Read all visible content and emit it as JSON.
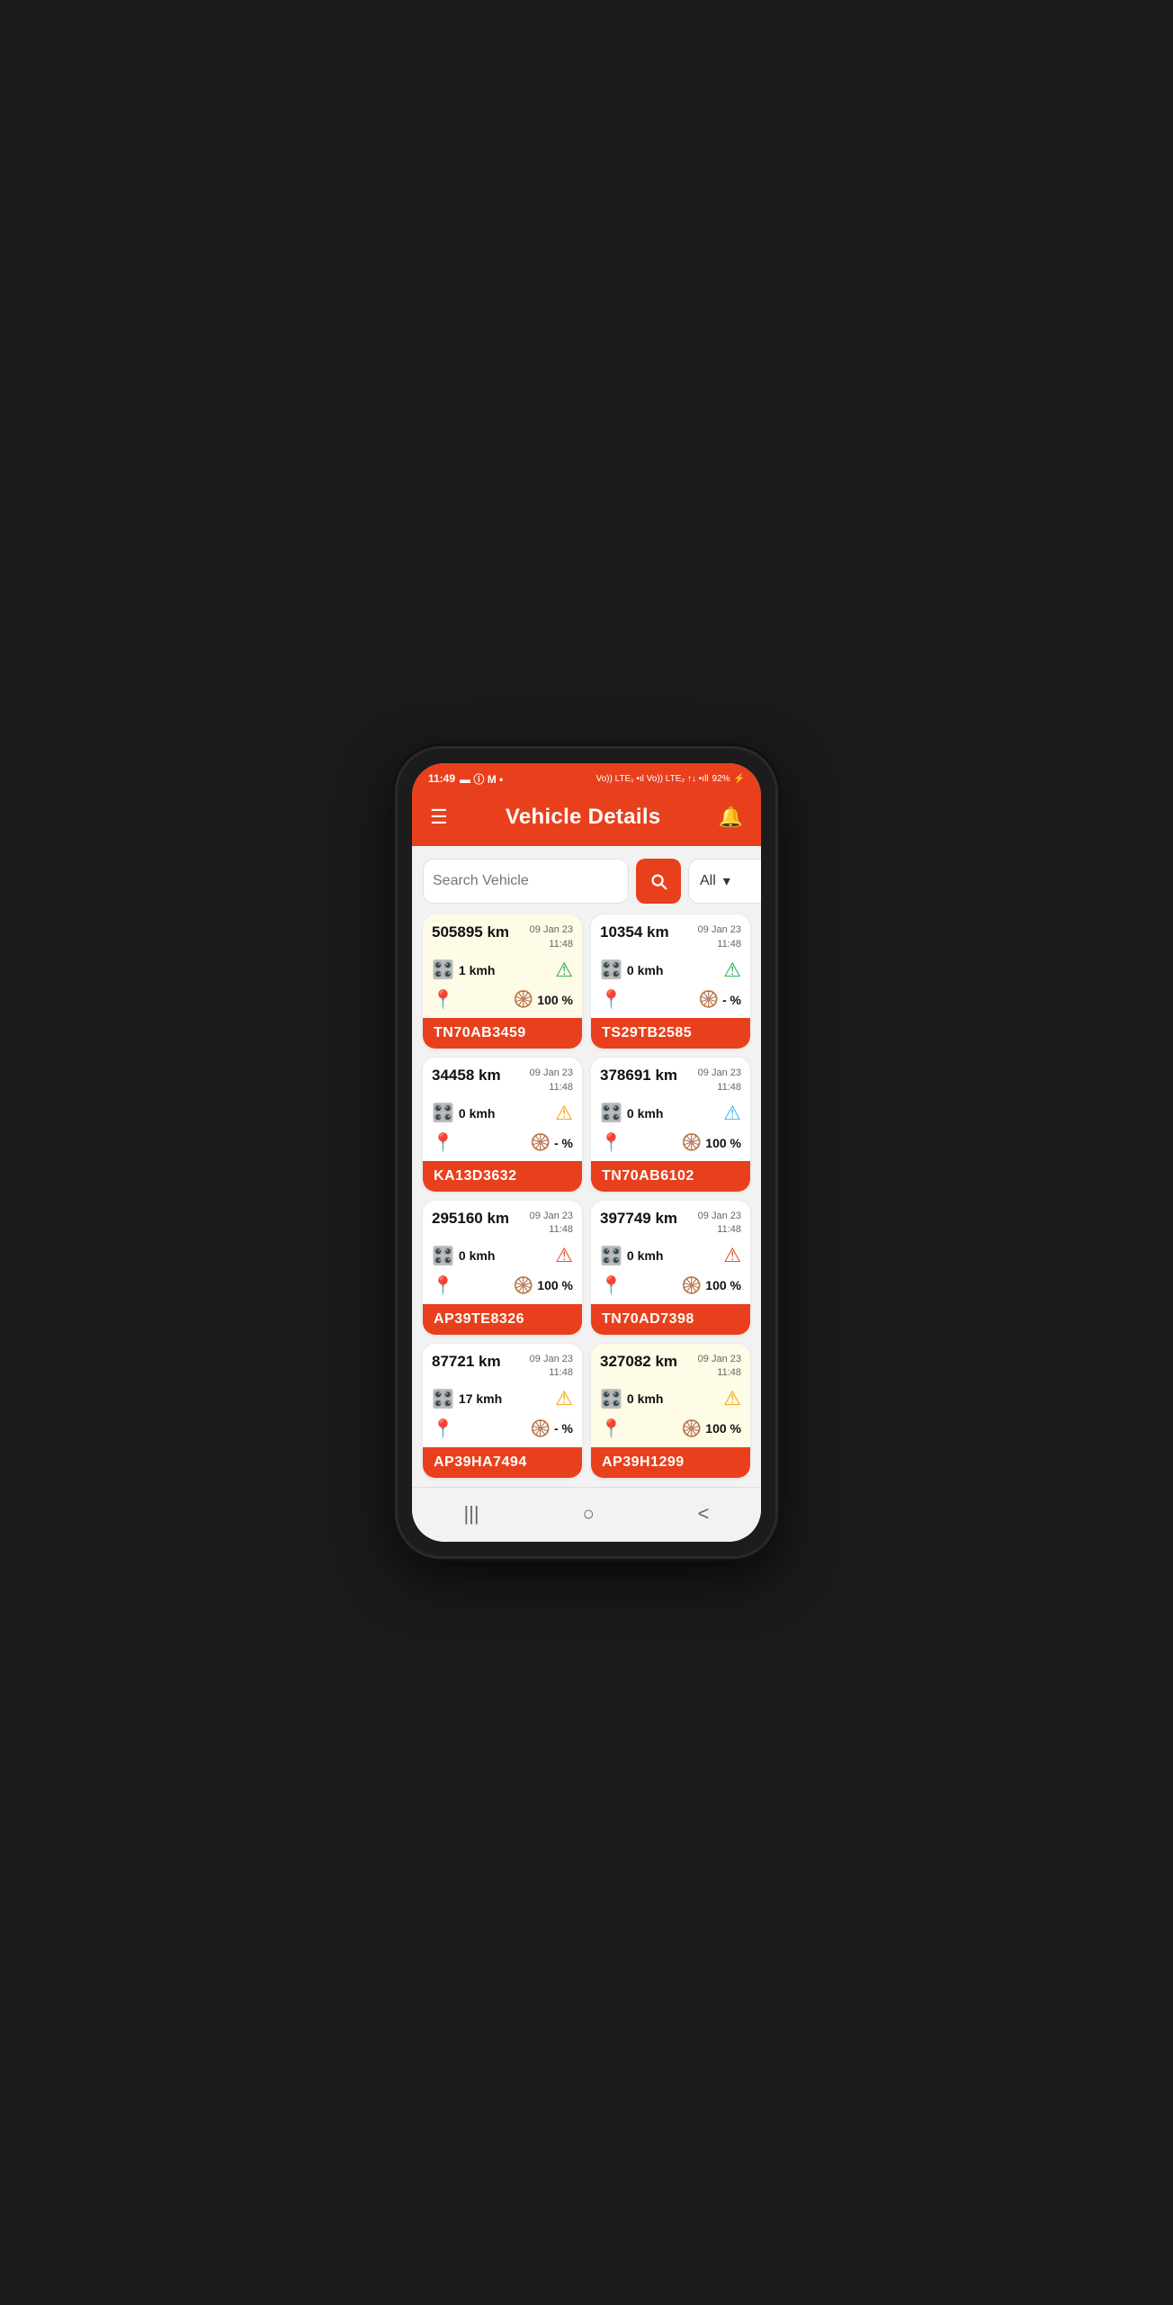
{
  "statusBar": {
    "time": "11:49",
    "batteryPct": "92%"
  },
  "header": {
    "title": "Vehicle Details",
    "menuLabel": "☰",
    "bellLabel": "🔔"
  },
  "search": {
    "placeholder": "Search Vehicle",
    "buttonIcon": "search",
    "filterDefault": "All"
  },
  "vehicles": [
    {
      "id": "v1",
      "km": "505895 km",
      "date": "09 Jan 23",
      "time": "11:48",
      "speed": "1 kmh",
      "warnColor": "green",
      "fuel": "100 %",
      "plate": "TN70AB3459",
      "highlighted": true
    },
    {
      "id": "v2",
      "km": "10354 km",
      "date": "09 Jan 23",
      "time": "11:48",
      "speed": "0 kmh",
      "warnColor": "green",
      "fuel": "- %",
      "plate": "TS29TB2585",
      "highlighted": false
    },
    {
      "id": "v3",
      "km": "34458 km",
      "date": "09 Jan 23",
      "time": "11:48",
      "speed": "0 kmh",
      "warnColor": "orange",
      "fuel": "- %",
      "plate": "KA13D3632",
      "highlighted": false
    },
    {
      "id": "v4",
      "km": "378691 km",
      "date": "09 Jan 23",
      "time": "11:48",
      "speed": "0 kmh",
      "warnColor": "blue",
      "fuel": "100 %",
      "plate": "TN70AB6102",
      "highlighted": false
    },
    {
      "id": "v5",
      "km": "295160 km",
      "date": "09 Jan 23",
      "time": "11:48",
      "speed": "0 kmh",
      "warnColor": "red",
      "fuel": "100 %",
      "plate": "AP39TE8326",
      "highlighted": false
    },
    {
      "id": "v6",
      "km": "397749 km",
      "date": "09 Jan 23",
      "time": "11:48",
      "speed": "0 kmh",
      "warnColor": "red",
      "fuel": "100 %",
      "plate": "TN70AD7398",
      "highlighted": false
    },
    {
      "id": "v7",
      "km": "87721 km",
      "date": "09 Jan 23",
      "time": "11:48",
      "speed": "17 kmh",
      "warnColor": "orange",
      "fuel": "- %",
      "plate": "AP39HA7494",
      "highlighted": false
    },
    {
      "id": "v8",
      "km": "327082 km",
      "date": "09 Jan 23",
      "time": "11:48",
      "speed": "0 kmh",
      "warnColor": "orange",
      "fuel": "100 %",
      "plate": "AP39H1299",
      "highlighted": true
    }
  ],
  "navbar": {
    "recentLabel": "|||",
    "homeLabel": "○",
    "backLabel": "<"
  }
}
